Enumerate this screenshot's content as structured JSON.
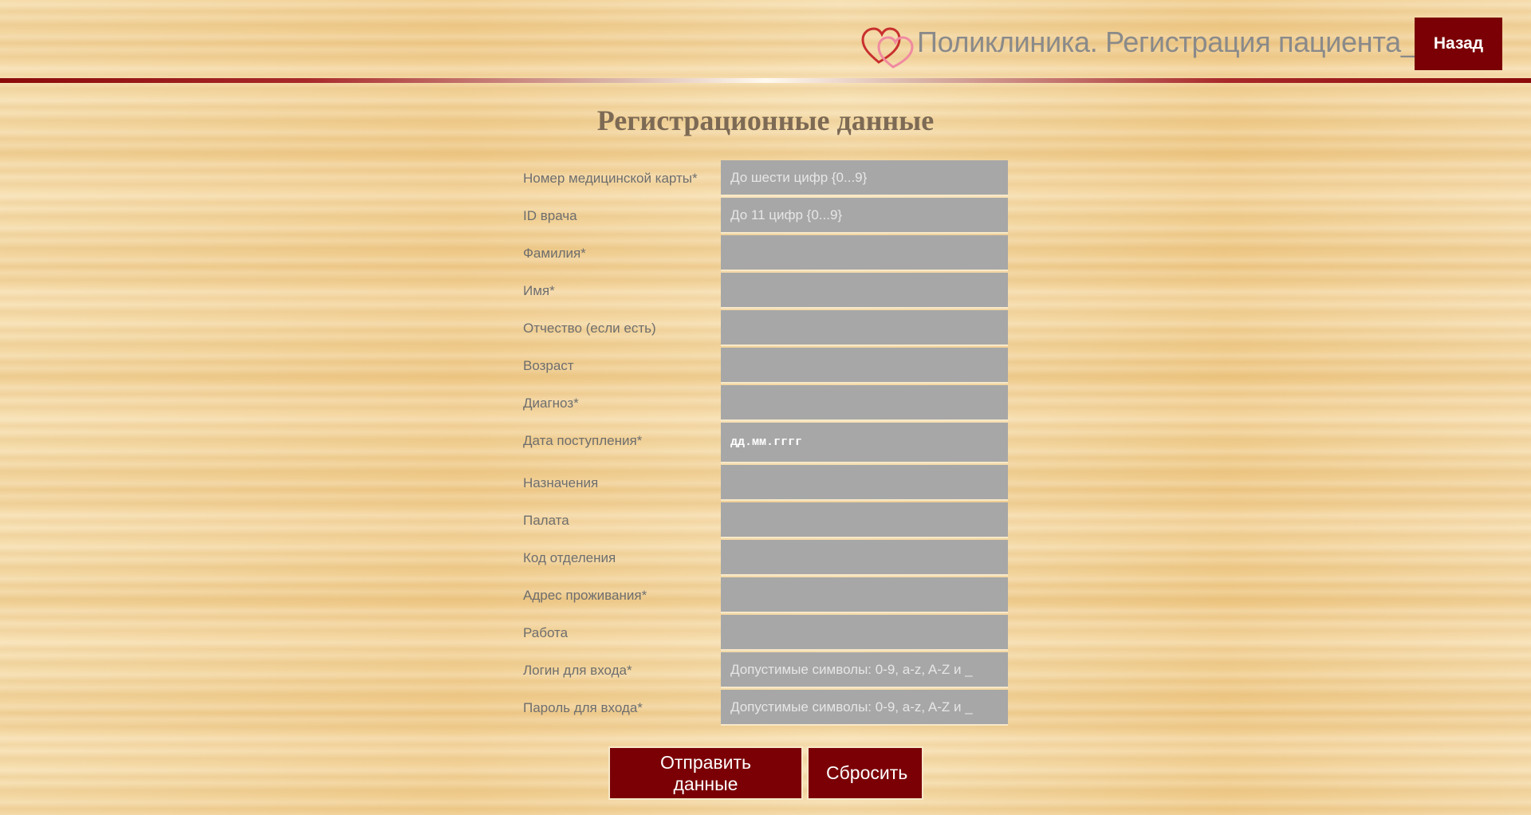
{
  "header": {
    "logo_icon": "hearts-icon",
    "title": "Поликлиника. Регистрация пациента__",
    "back_label": "Назад"
  },
  "form": {
    "title": "Регистрационные данные",
    "fields": [
      {
        "label": "Номер медицинской карты*",
        "placeholder": "До шести цифр {0...9}",
        "value": ""
      },
      {
        "label": "ID врача",
        "placeholder": "До 11 цифр {0...9}",
        "value": ""
      },
      {
        "label": "Фамилия*",
        "placeholder": "",
        "value": ""
      },
      {
        "label": "Имя*",
        "placeholder": "",
        "value": ""
      },
      {
        "label": "Отчество (если есть)",
        "placeholder": "",
        "value": ""
      },
      {
        "label": "Возраст",
        "placeholder": "",
        "value": ""
      },
      {
        "label": "Диагноз*",
        "placeholder": "",
        "value": ""
      },
      {
        "label": "Дата поступления*",
        "placeholder": "дд.мм.гггг",
        "value": ""
      },
      {
        "label": "Назначения",
        "placeholder": "",
        "value": ""
      },
      {
        "label": "Палата",
        "placeholder": "",
        "value": ""
      },
      {
        "label": "Код отделения",
        "placeholder": "",
        "value": ""
      },
      {
        "label": "Адрес проживания*",
        "placeholder": "",
        "value": ""
      },
      {
        "label": "Работа",
        "placeholder": "",
        "value": ""
      },
      {
        "label": "Логин для входа*",
        "placeholder": "Допустимые символы: 0-9, a-z, A-Z и _",
        "value": ""
      },
      {
        "label": "Пароль для входа*",
        "placeholder": "Допустимые символы: 0-9, a-z, A-Z и _",
        "value": ""
      }
    ],
    "submit_label": "Отправить данные",
    "reset_label": "Сбросить"
  },
  "colors": {
    "accent": "#7a0005",
    "input_bg": "#a7a7a7",
    "label_text": "#6e6e6e",
    "title_text": "#7d6a55"
  }
}
